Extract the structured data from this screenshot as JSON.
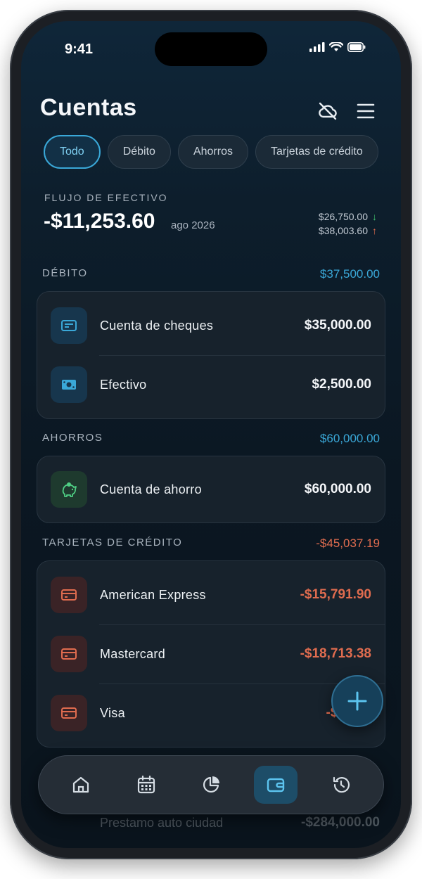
{
  "status": {
    "time": "9:41"
  },
  "header": {
    "title": "Cuentas"
  },
  "tabs": [
    {
      "label": "Todo"
    },
    {
      "label": "Débito"
    },
    {
      "label": "Ahorros"
    },
    {
      "label": "Tarjetas de crédito"
    }
  ],
  "cash_flow": {
    "label": "FLUJO DE EFECTIVO",
    "amount": "-$11,253.60",
    "period": "ago 2026",
    "income": "$26,750.00",
    "expenses": "$38,003.60"
  },
  "sections": {
    "debit": {
      "name": "DÉBITO",
      "total": "$37,500.00",
      "items": [
        {
          "name": "Cuenta de cheques",
          "value": "$35,000.00"
        },
        {
          "name": "Efectivo",
          "value": "$2,500.00"
        }
      ]
    },
    "savings": {
      "name": "AHORROS",
      "total": "$60,000.00",
      "items": [
        {
          "name": "Cuenta de ahorro",
          "value": "$60,000.00"
        }
      ]
    },
    "credit": {
      "name": "TARJETAS DE CRÉDITO",
      "total": "-$45,037.19",
      "items": [
        {
          "name": "American Express",
          "value": "-$15,791.90"
        },
        {
          "name": "Mastercard",
          "value": "-$18,713.38"
        },
        {
          "name": "Visa",
          "value": "-$10,53"
        }
      ]
    },
    "loans_partial": {
      "name": "Prestamo auto ciudad",
      "value": "-$284,000.00"
    }
  },
  "colors": {
    "accent": "#3aa8d8",
    "negative": "#e06c4f",
    "positive": "#3fbf6b"
  },
  "nav": [
    "home-icon",
    "calendar-icon",
    "pie-chart-icon",
    "wallet-icon",
    "history-icon"
  ]
}
